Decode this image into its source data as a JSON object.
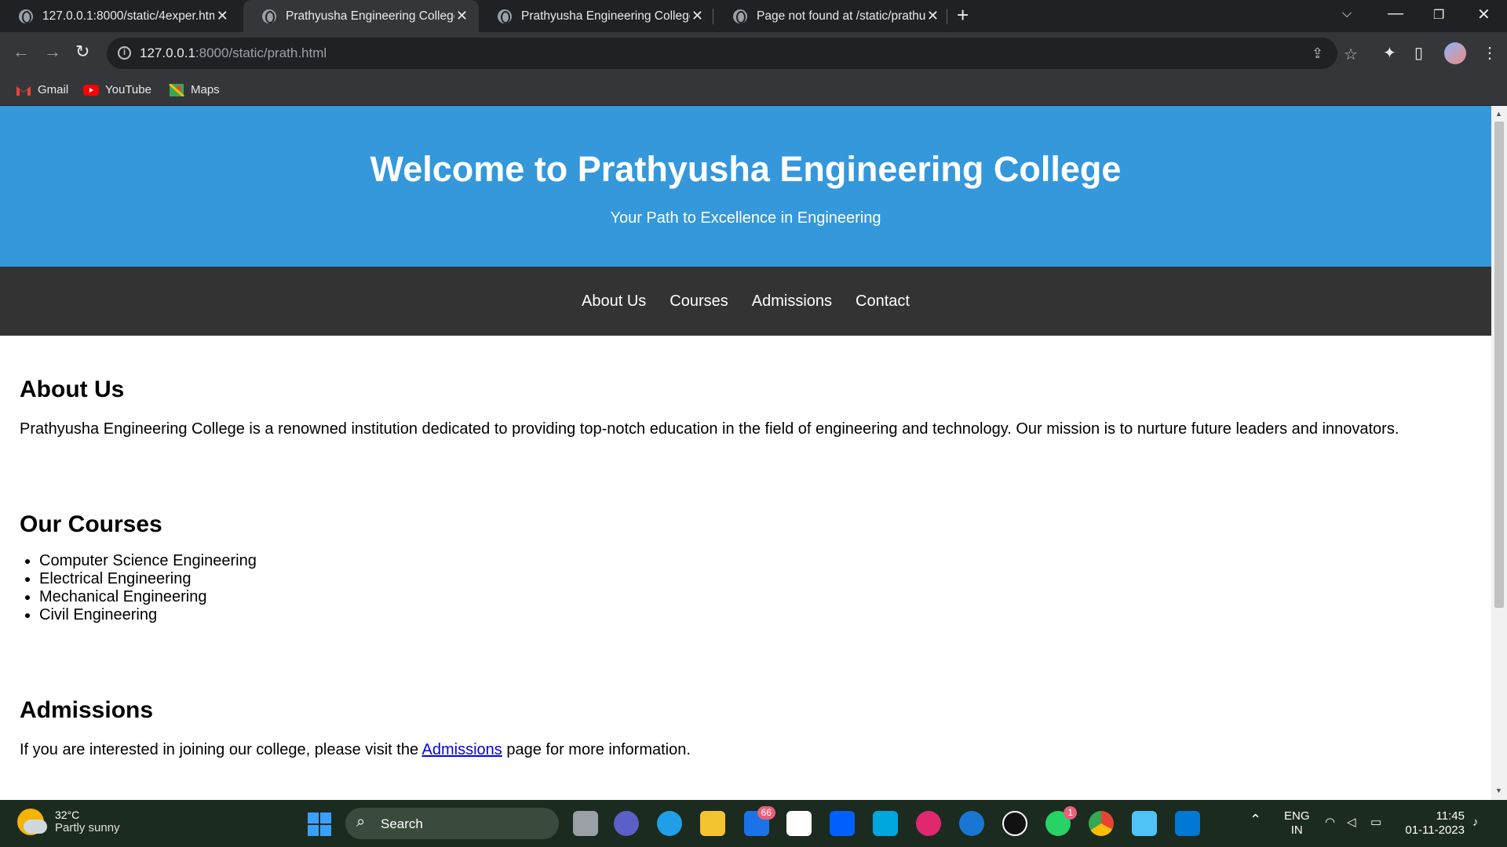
{
  "browser": {
    "tabs": [
      {
        "title": "127.0.0.1:8000/static/4exper.htm",
        "active": false
      },
      {
        "title": "Prathyusha Engineering College",
        "active": true
      },
      {
        "title": "Prathyusha Engineering College",
        "active": false
      },
      {
        "title": "Page not found at /static/prathu",
        "active": false
      }
    ],
    "url_host": "127.0.0.1",
    "url_rest": ":8000/static/prath.html",
    "bookmarks": [
      "Gmail",
      "YouTube",
      "Maps"
    ]
  },
  "page": {
    "header": {
      "title": "Welcome to Prathyusha Engineering College",
      "tagline": "Your Path to Excellence in Engineering"
    },
    "nav": [
      "About Us",
      "Courses",
      "Admissions",
      "Contact"
    ],
    "about": {
      "heading": "About Us",
      "text": "Prathyusha Engineering College is a renowned institution dedicated to providing top-notch education in the field of engineering and technology. Our mission is to nurture future leaders and innovators."
    },
    "courses": {
      "heading": "Our Courses",
      "items": [
        "Computer Science Engineering",
        "Electrical Engineering",
        "Mechanical Engineering",
        "Civil Engineering"
      ]
    },
    "admissions": {
      "heading": "Admissions",
      "text_before": "If you are interested in joining our college, please visit the",
      "link": "Admissions",
      "text_after": "page for more information."
    }
  },
  "taskbar": {
    "weather_temp": "32°C",
    "weather_desc": "Partly sunny",
    "search_label": "Search",
    "mail_badge": "66",
    "whatsapp_badge": "1",
    "language_top": "ENG",
    "language_bottom": "IN",
    "time": "11:45",
    "date": "01-11-2023"
  },
  "colors": {
    "header_bg": "#3498db",
    "nav_bg": "#333333",
    "link": "#0000ee"
  }
}
